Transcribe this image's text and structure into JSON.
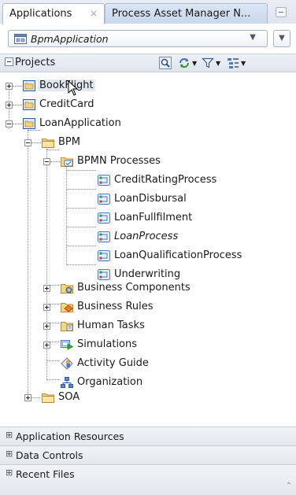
{
  "tabs": [
    {
      "label": "Applications",
      "active": true
    },
    {
      "label": "Process Asset Manager N...",
      "active": false
    }
  ],
  "application_selector": {
    "value": "BpmApplication"
  },
  "projects_panel": {
    "title": "Projects"
  },
  "tree": {
    "nodes": [
      {
        "label": "BookFlight",
        "icon": "project-folder-icon"
      },
      {
        "label": "CreditCard",
        "icon": "project-folder-icon"
      },
      {
        "label": "LoanApplication",
        "icon": "project-folder-icon"
      },
      {
        "label": "BPM",
        "icon": "folder-icon"
      },
      {
        "label": "BPMN Processes",
        "icon": "processes-folder-icon"
      },
      {
        "label": "CreditRatingProcess",
        "icon": "process-icon"
      },
      {
        "label": "LoanDisbursal",
        "icon": "process-icon"
      },
      {
        "label": "LoanFullfilment",
        "icon": "process-icon"
      },
      {
        "label": "LoanProcess",
        "icon": "process-icon",
        "italic": true
      },
      {
        "label": "LoanQualificationProcess",
        "icon": "process-icon"
      },
      {
        "label": "Underwriting",
        "icon": "process-icon"
      },
      {
        "label": "Business Components",
        "icon": "business-components-icon"
      },
      {
        "label": "Business Rules",
        "icon": "business-rules-icon"
      },
      {
        "label": "Human Tasks",
        "icon": "human-tasks-icon"
      },
      {
        "label": "Simulations",
        "icon": "simulations-icon"
      },
      {
        "label": "Activity Guide",
        "icon": "activity-guide-icon"
      },
      {
        "label": "Organization",
        "icon": "organization-icon"
      },
      {
        "label": "SOA",
        "icon": "folder-icon"
      }
    ]
  },
  "bottom_panels": [
    {
      "label": "Application Resources"
    },
    {
      "label": "Data Controls"
    },
    {
      "label": "Recent Files"
    }
  ],
  "colors": {
    "folder": "#f2d27a",
    "folder_border": "#b8892e",
    "process_blue": "#3f78c8",
    "tab_accent": "#c9d7ec"
  }
}
